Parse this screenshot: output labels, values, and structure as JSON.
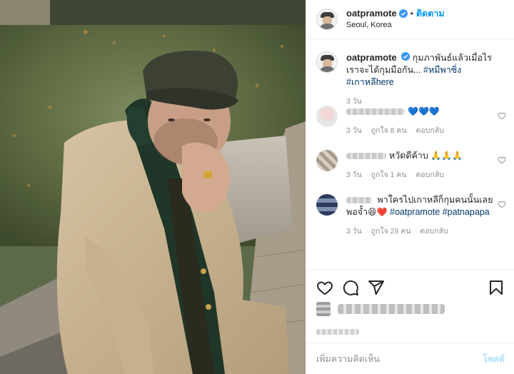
{
  "header": {
    "username": "oatpramote",
    "separator": "•",
    "follow_label": "ติดตาม",
    "location": "Seoul, Korea"
  },
  "caption": {
    "username": "oatpramote",
    "text": "กุมภาพันธ์แล้วเมื่อไรเราจะได้กุมมือกัน...",
    "hashtags": [
      "#หมีพาซิ่ง",
      "#เกาหลีhere"
    ],
    "time": "3 วัน"
  },
  "comments": [
    {
      "text": "",
      "emoji": "💙💙💙",
      "time": "3 วัน",
      "likes": "ถูกใจ 8 คน",
      "reply": "ตอบกลับ"
    },
    {
      "text": "หวัดดีค้าบ",
      "emoji": "🙏🙏🙏",
      "time": "3 วัน",
      "likes": "ถูกใจ 1 คน",
      "reply": "ตอบกลับ"
    },
    {
      "text": "พาใครไปเกาหลีก็กุมคนนั้นเลยพอจ้ำ",
      "emoji": "😆❤️",
      "hashtags": [
        "#oatpramote",
        "#patnapapa"
      ],
      "time": "3 วัน",
      "likes": "ถูกใจ 29 คน",
      "reply": "ตอบกลับ"
    }
  ],
  "actions": {
    "like_icon": "heart-icon",
    "comment_icon": "comment-icon",
    "share_icon": "share-icon",
    "save_icon": "bookmark-icon"
  },
  "add_comment": {
    "placeholder": "เพิ่มความคิดเห็น",
    "post_label": "โพสต์"
  },
  "colors": {
    "accent": "#0095f6",
    "hashtag": "#00376b",
    "muted": "#8e8e8e",
    "border": "#efefef"
  }
}
